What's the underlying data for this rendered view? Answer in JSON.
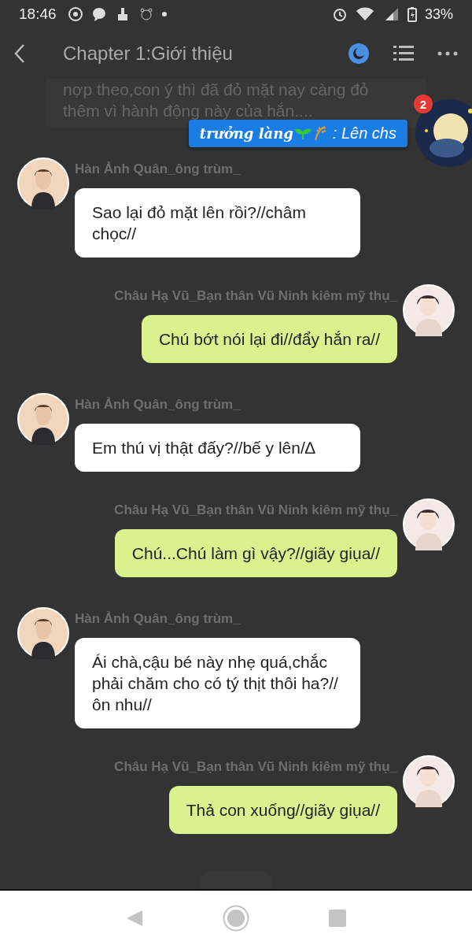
{
  "status_bar": {
    "time": "18:46",
    "battery": "33%"
  },
  "header": {
    "title": "Chapter 1:Giới thiệu"
  },
  "narration": {
    "lines": [
      "nợp theo,con ý thì đã đỏ mặt nay càng đỏ",
      "thêm vì hành động này của hắn...."
    ]
  },
  "floating_bubble": {
    "name": "trưởng làng",
    "message": ": Lên chs",
    "badge": "2"
  },
  "messages": [
    {
      "kind": "left",
      "name": "Hàn Ảnh Quân_ông trùm_",
      "text": "Sao lại đỏ mặt lên rồi?//châm chọc//"
    },
    {
      "kind": "right",
      "name": "Châu Hạ Vũ_Bạn thân Vũ Ninh kiêm mỹ thụ_",
      "text": "Chú bớt nói lại đi//đẩy hắn ra//"
    },
    {
      "kind": "left",
      "name": "Hàn Ảnh Quân_ông trùm_",
      "text": "Em thú vị thật đấy?//bế y lên/∆"
    },
    {
      "kind": "right",
      "name": "Châu Hạ Vũ_Bạn thân Vũ Ninh kiêm mỹ thụ_",
      "text": "Chú...Chú làm gì vậy?//giãy giụa//"
    },
    {
      "kind": "left",
      "name": "Hàn Ảnh Quân_ông trùm_",
      "text": "Ái chà,cậu bé này nhẹ quá,chắc phải chăm cho có tý thịt thôi ha?//ôn nhu//"
    },
    {
      "kind": "right",
      "name": "Châu Hạ Vũ_Bạn thân Vũ Ninh kiêm mỹ thụ_",
      "text": "Thả con xuống//giãy giụa//"
    }
  ]
}
